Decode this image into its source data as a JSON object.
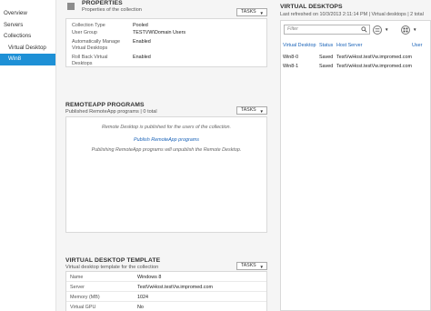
{
  "nav": {
    "items": [
      {
        "label": "Overview"
      },
      {
        "label": "Servers"
      },
      {
        "label": "Collections"
      },
      {
        "label": "Virtual Desktop"
      },
      {
        "label": "Win8"
      }
    ]
  },
  "properties": {
    "title": "PROPERTIES",
    "subtitle": "Properties of the collection",
    "tasks_label": "TASKS",
    "rows": [
      {
        "key": "Collection Type",
        "value": "Pooled"
      },
      {
        "key": "User Group",
        "value": "TESTVW\\Domain Users"
      },
      {
        "key": "Automatically Manage Virtual Desktops",
        "value": "Enabled"
      },
      {
        "key": "Roll Back Virtual Desktops",
        "value": "Enabled"
      }
    ]
  },
  "remoteapp": {
    "title": "REMOTEAPP PROGRAMS",
    "subtitle": "Published RemoteApp programs | 0 total",
    "tasks_label": "TASKS",
    "line1": "Remote Desktop is published for the users of the collection.",
    "link": "Publish RemoteApp programs",
    "line2": "Publishing RemoteApp programs will unpublish the Remote Desktop."
  },
  "template": {
    "title": "VIRTUAL DESKTOP TEMPLATE",
    "subtitle": "Virtual desktop template for the collection",
    "tasks_label": "TASKS",
    "rows": [
      {
        "key": "Name",
        "value": "Windows 8"
      },
      {
        "key": "Server",
        "value": "TestVwHost.testVw.impromed.com"
      },
      {
        "key": "Memory (MB)",
        "value": "1024"
      },
      {
        "key": "Virtual GPU",
        "value": "No"
      }
    ]
  },
  "virtual_desktops": {
    "title": "VIRTUAL DESKTOPS",
    "subtitle": "Last refreshed on 10/3/2013 2:11:14 PM | Virtual desktops | 2 total",
    "filter_placeholder": "Filter",
    "columns": [
      "Virtual Desktop",
      "Status",
      "Host Server",
      "User"
    ],
    "rows": [
      {
        "name": "Win8-0",
        "status": "Saved",
        "host": "TestVwHost.testVw.impromed.com"
      },
      {
        "name": "Win8-1",
        "status": "Saved",
        "host": "TestVwHost.testVw.impromed.com"
      }
    ]
  }
}
